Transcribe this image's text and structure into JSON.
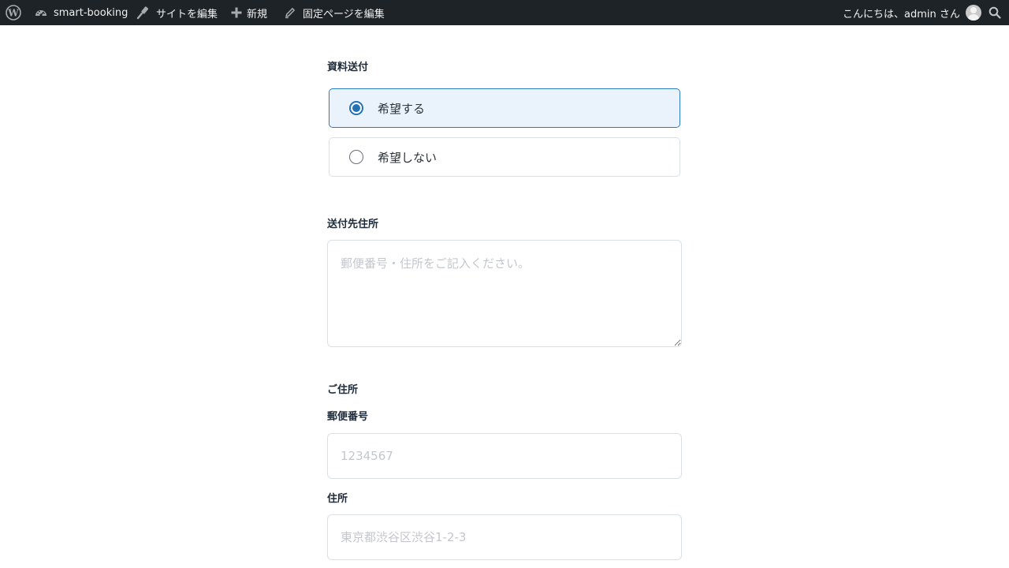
{
  "admin_bar": {
    "wp_logo_icon": "wordpress-logo-icon",
    "site_name": "smart-booking",
    "customize": "サイトを編集",
    "new": "新規",
    "edit_page": "固定ページを編集",
    "account": "こんにちは、admin さん",
    "colors": {
      "background": "#1d2327",
      "text": "#f0f0f1"
    }
  },
  "form": {
    "material_send": {
      "label": "資料送付",
      "options": [
        {
          "label": "希望する",
          "selected": true
        },
        {
          "label": "希望しない",
          "selected": false
        }
      ]
    },
    "send_address": {
      "label": "送付先住所",
      "placeholder": "郵便番号・住所をご記入ください。",
      "value": ""
    },
    "home_address": {
      "section_label": "ご住所",
      "postal_code": {
        "label": "郵便番号",
        "placeholder": "1234567",
        "value": ""
      },
      "address": {
        "label": "住所",
        "placeholder": "東京都渋谷区渋谷1-2-3",
        "value": ""
      }
    },
    "colors": {
      "accent": "#2272b6",
      "selected_bg": "#eaf3fc",
      "border": "#dcdfe4"
    }
  }
}
